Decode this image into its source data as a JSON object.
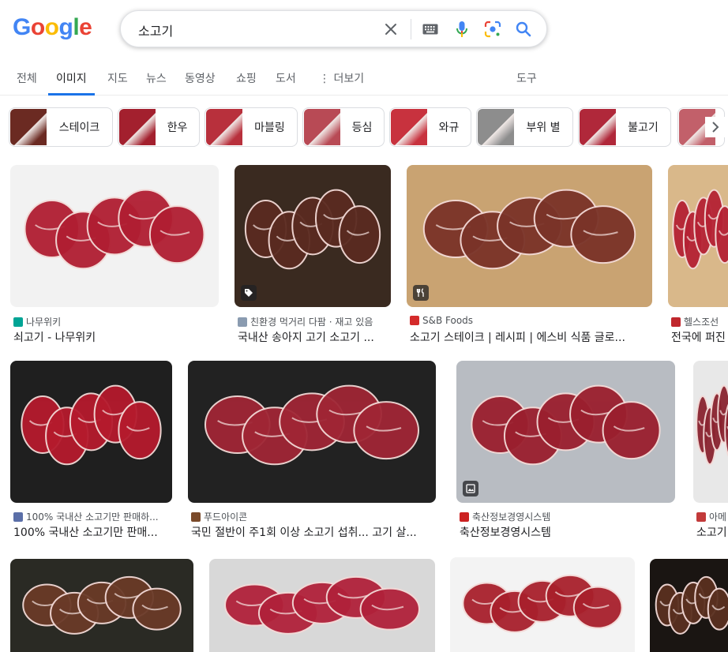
{
  "logo": {
    "letters": [
      "G",
      "o",
      "o",
      "g",
      "l",
      "e"
    ],
    "colors": [
      "#4285F4",
      "#EA4335",
      "#FBBC05",
      "#4285F4",
      "#34A853",
      "#EA4335"
    ]
  },
  "search": {
    "query": "소고기",
    "icons": [
      "close-icon",
      "keyboard-icon",
      "mic-icon",
      "lens-icon",
      "search-icon"
    ]
  },
  "tabs": [
    {
      "label": "전체"
    },
    {
      "label": "이미지",
      "active": true
    },
    {
      "label": "지도"
    },
    {
      "label": "뉴스"
    },
    {
      "label": "동영상"
    },
    {
      "label": "쇼핑"
    },
    {
      "label": "도서"
    },
    {
      "label": "⋮ 더보기"
    },
    {
      "label": "도구"
    }
  ],
  "chips": [
    {
      "label": "스테이크",
      "color": "#6b2a22"
    },
    {
      "label": "한우",
      "color": "#a3202e"
    },
    {
      "label": "마블링",
      "color": "#b8303c"
    },
    {
      "label": "등심",
      "color": "#b84a55"
    },
    {
      "label": "와규",
      "color": "#c8323e"
    },
    {
      "label": "부위 별",
      "color": "#8d8d8d"
    },
    {
      "label": "불고기",
      "color": "#b0283a"
    },
    {
      "label": "",
      "color": "#c2606a"
    }
  ],
  "results": [
    {
      "source": "나무위키",
      "title": "쇠고기 - 나무위키",
      "bg": "#f2f2f2",
      "meat": "#b01e32",
      "fav": "#00a495"
    },
    {
      "source": "친환경 먹거리 다팜 · 재고 있음",
      "title": "국내산 송아지 고기 소고기 ...",
      "bg": "#3a2a20",
      "meat": "#5a2a20",
      "fav": "#8a9bb0"
    },
    {
      "source": "S&B Foods",
      "title": "소고기 스테이크 | 레시피 | 에스비 식품 글로...",
      "bg": "#c9a372",
      "meat": "#7a3328",
      "fav": "#d42b2b"
    },
    {
      "source": "헬스조선",
      "title": "전국에 퍼진",
      "bg": "#d9b88a",
      "meat": "#b52234",
      "fav": "#c0272d"
    },
    {
      "source": "100% 국내산 소고기만 판매하...",
      "title": "100% 국내산 소고기만 판매...",
      "bg": "#1f1f1f",
      "meat": "#b51a2d",
      "fav": "#5b6fa8"
    },
    {
      "source": "푸드아이콘",
      "title": "국민 절반이 주1회 이상 소고기 섭취... 고기 살...",
      "bg": "#222222",
      "meat": "#a02635",
      "fav": "#7a4a2a"
    },
    {
      "source": "축산정보경영시스템",
      "title": "축산정보경영시스템",
      "bg": "#b8bcc2",
      "meat": "#9a1f2e",
      "fav": "#cc2222"
    },
    {
      "source": "아메",
      "title": "소고기",
      "bg": "#e8e8e8",
      "meat": "#8a2430",
      "fav": "#c23a3a"
    },
    {
      "source": "",
      "title": "",
      "bg": "#2a2a24",
      "meat": "#6a3a28",
      "fav": "#888888"
    },
    {
      "source": "",
      "title": "",
      "bg": "#d8d8d8",
      "meat": "#b0213a",
      "fav": "#888888"
    },
    {
      "source": "",
      "title": "",
      "bg": "#f3f3f3",
      "meat": "#a8202c",
      "fav": "#888888"
    },
    {
      "source": "",
      "title": "",
      "bg": "#1a1512",
      "meat": "#5a3020",
      "fav": "#888888"
    }
  ]
}
